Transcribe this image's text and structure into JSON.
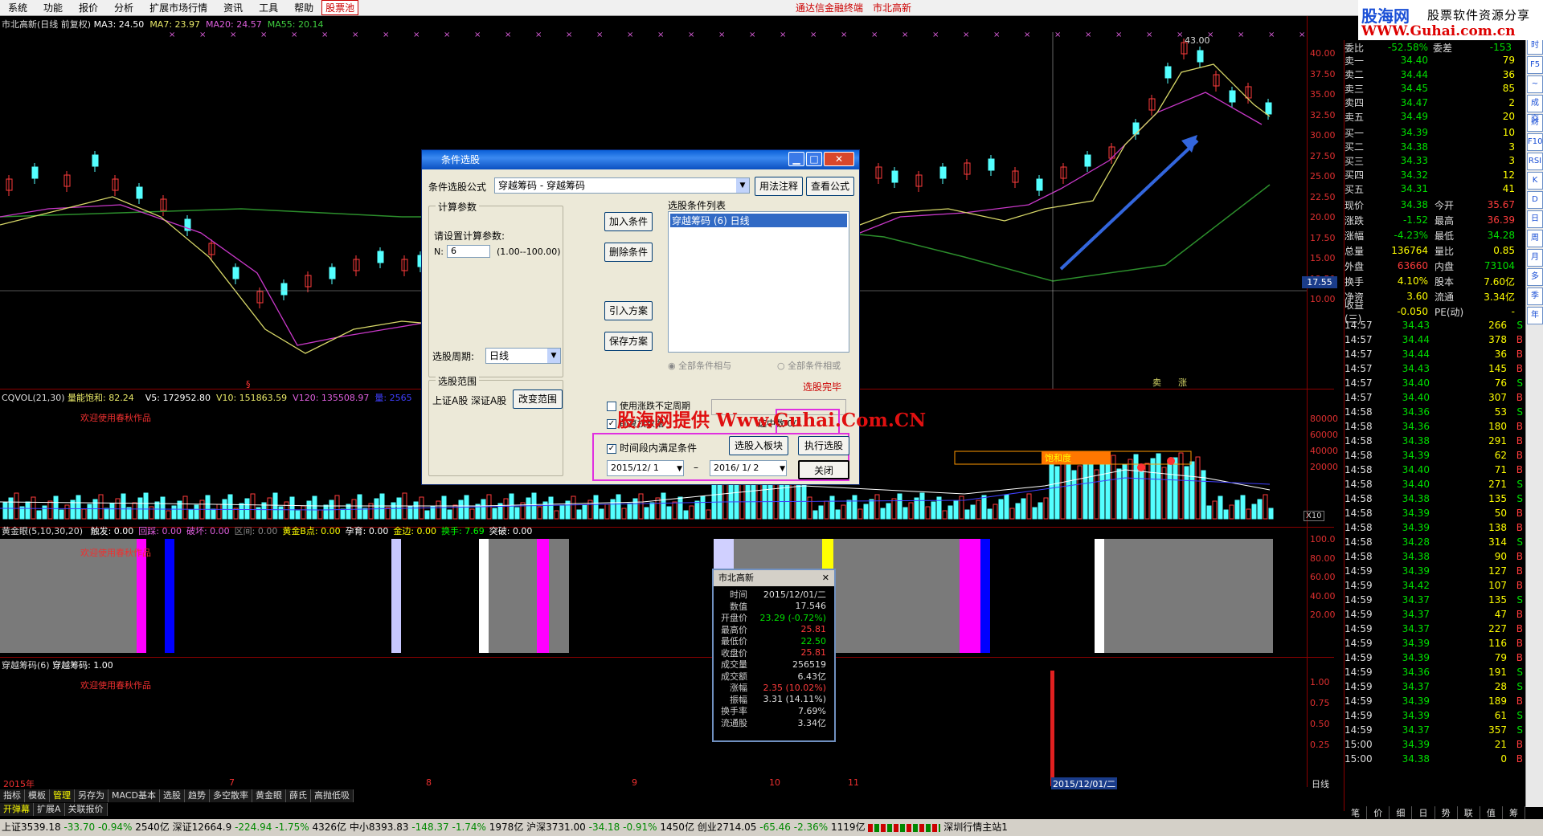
{
  "menu": {
    "items": [
      "系统",
      "功能",
      "报价",
      "分析",
      "扩展市场行情",
      "资讯",
      "工具",
      "帮助"
    ],
    "hot": "股票池",
    "center1": "通达信金融终端",
    "center2": "市北高新"
  },
  "logo": {
    "site": "股海网",
    "slogan": "股票软件资源分享",
    "url": "WWW.Guhai.com.cn"
  },
  "kline": {
    "header": "市北高新(日线 前复权)",
    "ma3": "MA3: 24.50",
    "ma7": "MA7: 23.97",
    "ma20": "MA20: 24.57",
    "ma55": "MA55: 20.14",
    "peak": "43.00",
    "cross_price": "17.55",
    "yaxis": [
      "40.00",
      "37.50",
      "35.00",
      "32.50",
      "30.00",
      "27.50",
      "25.00",
      "22.50",
      "20.00",
      "17.50",
      "15.00",
      "12.50",
      "10.00"
    ],
    "marks": [
      "卖",
      "涨"
    ]
  },
  "vol": {
    "header": "CQVOL(21,30)",
    "sat": "量能饱和: 82.24",
    "v5": "V5: 172952.80",
    "v10": "V10: 151863.59",
    "v120": "V120: 135508.97",
    "vol": "量: 2565",
    "welcome": "欢迎使用春秋作品",
    "yaxis": [
      "80000",
      "60000",
      "40000",
      "20000"
    ],
    "scale": "X10",
    "band": "饱和度"
  },
  "gold": {
    "header": "黄金眼(5,10,30,20)",
    "items": [
      {
        "k": "触发",
        "v": "0.00"
      },
      {
        "k": "回踩",
        "v": "0.00"
      },
      {
        "k": "破坏",
        "v": "0.00"
      },
      {
        "k": "区间",
        "v": "0.00"
      },
      {
        "k": "黄金B点",
        "v": "0.00"
      },
      {
        "k": "孕育",
        "v": "0.00"
      },
      {
        "k": "金边",
        "v": "0.00"
      },
      {
        "k": "换手",
        "v": "7.69"
      },
      {
        "k": "突破",
        "v": "0.00"
      }
    ],
    "welcome": "欢迎使用春秋作品",
    "yaxis": [
      "100.0",
      "80.00",
      "60.00",
      "40.00",
      "20.00"
    ]
  },
  "chip": {
    "header": "穿越筹码(6)",
    "value": "穿越筹码: 1.00",
    "welcome": "欢迎使用春秋作品",
    "yaxis": [
      "1.00",
      "0.75",
      "0.50",
      "0.25"
    ]
  },
  "xaxis": {
    "labels": [
      "2015年",
      "7",
      "8",
      "9",
      "10",
      "11"
    ],
    "cursor": "2015/12/01/二",
    "period": "日线"
  },
  "quote": {
    "header": {
      "k1": "委比",
      "v1": "-52.58%",
      "k2": "委差",
      "v2": "-153"
    },
    "asks": [
      {
        "k": "卖五",
        "p": "34.49",
        "v": "20"
      },
      {
        "k": "卖四",
        "p": "34.47",
        "v": "2"
      },
      {
        "k": "卖三",
        "p": "34.45",
        "v": "85"
      },
      {
        "k": "卖二",
        "p": "34.44",
        "v": "36"
      },
      {
        "k": "卖一",
        "p": "34.40",
        "v": "79"
      }
    ],
    "bids": [
      {
        "k": "买一",
        "p": "34.39",
        "v": "10"
      },
      {
        "k": "买二",
        "p": "34.38",
        "v": "3"
      },
      {
        "k": "买三",
        "p": "34.33",
        "v": "3"
      },
      {
        "k": "买四",
        "p": "34.32",
        "v": "12"
      },
      {
        "k": "买五",
        "p": "34.31",
        "v": "41"
      }
    ],
    "stats": [
      {
        "k1": "现价",
        "v1": "34.38",
        "k2": "今开",
        "v2": "35.67"
      },
      {
        "k1": "涨跌",
        "v1": "-1.52",
        "k2": "最高",
        "v2": "36.39"
      },
      {
        "k1": "涨幅",
        "v1": "-4.23%",
        "k2": "最低",
        "v2": "34.28"
      },
      {
        "k1": "总量",
        "v1": "136764",
        "k2": "量比",
        "v2": "0.85"
      },
      {
        "k1": "外盘",
        "v1": "63660",
        "k2": "内盘",
        "v2": "73104"
      },
      {
        "k1": "换手",
        "v1": "4.10%",
        "k2": "股本",
        "v2": "7.60亿"
      },
      {
        "k1": "净资",
        "v1": "3.60",
        "k2": "流通",
        "v2": "3.34亿"
      },
      {
        "k1": "收益(三)",
        "v1": "-0.050",
        "k2": "PE(动)",
        "v2": "-"
      }
    ],
    "ticks": [
      [
        "14:57",
        "34.43",
        "266",
        "S"
      ],
      [
        "14:57",
        "34.44",
        "378",
        "B"
      ],
      [
        "14:57",
        "34.44",
        "36",
        "B"
      ],
      [
        "14:57",
        "34.43",
        "145",
        "B"
      ],
      [
        "14:57",
        "34.40",
        "76",
        "S"
      ],
      [
        "14:57",
        "34.40",
        "307",
        "B"
      ],
      [
        "14:58",
        "34.36",
        "53",
        "S"
      ],
      [
        "14:58",
        "34.36",
        "180",
        "B"
      ],
      [
        "14:58",
        "34.38",
        "291",
        "B"
      ],
      [
        "14:58",
        "34.39",
        "62",
        "B"
      ],
      [
        "14:58",
        "34.40",
        "71",
        "B"
      ],
      [
        "14:58",
        "34.40",
        "271",
        "S"
      ],
      [
        "14:58",
        "34.38",
        "135",
        "S"
      ],
      [
        "14:58",
        "34.39",
        "50",
        "B"
      ],
      [
        "14:58",
        "34.39",
        "138",
        "B"
      ],
      [
        "14:58",
        "34.28",
        "314",
        "S"
      ],
      [
        "14:58",
        "34.38",
        "90",
        "B"
      ],
      [
        "14:59",
        "34.39",
        "127",
        "B"
      ],
      [
        "14:59",
        "34.42",
        "107",
        "B"
      ],
      [
        "14:59",
        "34.37",
        "135",
        "S"
      ],
      [
        "14:59",
        "34.37",
        "47",
        "B"
      ],
      [
        "14:59",
        "34.37",
        "227",
        "B"
      ],
      [
        "14:59",
        "34.39",
        "116",
        "B"
      ],
      [
        "14:59",
        "34.39",
        "79",
        "B"
      ],
      [
        "14:59",
        "34.36",
        "191",
        "S"
      ],
      [
        "14:59",
        "34.37",
        "28",
        "S"
      ],
      [
        "14:59",
        "34.39",
        "189",
        "B"
      ],
      [
        "14:59",
        "34.39",
        "61",
        "S"
      ],
      [
        "14:59",
        "34.37",
        "357",
        "S"
      ],
      [
        "15:00",
        "34.39",
        "21",
        "B"
      ],
      [
        "15:00",
        "34.38",
        "0",
        "B"
      ]
    ],
    "tabs": [
      "笔",
      "价",
      "细",
      "日",
      "势",
      "联",
      "值",
      "筹"
    ]
  },
  "side": [
    "分",
    "时",
    "F5",
    "~",
    "成交",
    "财",
    "F10",
    "RSI",
    "K",
    "D",
    "日",
    "周",
    "月",
    "多",
    "季",
    "年"
  ],
  "dialog": {
    "title": "条件选股",
    "formula_label": "条件选股公式",
    "formula_value": "穿越筹码     - 穿越筹码",
    "usage": "用法注释",
    "view": "查看公式",
    "calc_group": "计算参数",
    "calc_hint": "请设置计算参数:",
    "n_label": "N:",
    "n_value": "6",
    "n_range": "(1.00--100.00)",
    "add": "加入条件",
    "del": "删除条件",
    "import": "引入方案",
    "save": "保存方案",
    "list_label": "选股条件列表",
    "list_item": "穿越筹码 (6) 日线",
    "period_label": "选股周期:",
    "period_value": "日线",
    "and": "全部条件相与",
    "or": "全部条件相或",
    "range_group": "选股范围",
    "range_value": "上证A股 深证A股",
    "change_range": "改变范围",
    "done": "选股完毕",
    "uncertain": "使用涨跌不定周期",
    "prev_ex": "前复权数据",
    "count": "0/3",
    "count2": "选中数",
    "timecond": "时间段内满足条件",
    "to_block": "选股入板块",
    "execute": "执行选股",
    "date_from": "2015/12/ 1",
    "date_to": "2016/ 1/ 2",
    "close": "关闭"
  },
  "watermark": "股海网提供 Www.Guhai.Com.CN",
  "popup": {
    "title": "市北高新",
    "rows": [
      {
        "k": "时间",
        "v": "2015/12/01/二"
      },
      {
        "k": "数值",
        "v": "17.546"
      },
      {
        "k": "开盘价",
        "v": "23.29 (-0.72%)"
      },
      {
        "k": "最高价",
        "v": "25.81"
      },
      {
        "k": "最低价",
        "v": "22.50"
      },
      {
        "k": "收盘价",
        "v": "25.81"
      },
      {
        "k": "成交量",
        "v": "256519"
      },
      {
        "k": "成交额",
        "v": "6.43亿"
      },
      {
        "k": "涨幅",
        "v": "2.35 (10.02%)"
      },
      {
        "k": "振幅",
        "v": "3.31 (14.11%)"
      },
      {
        "k": "换手率",
        "v": "7.69%"
      },
      {
        "k": "流通股",
        "v": "3.34亿"
      }
    ]
  },
  "tabs": [
    "指标",
    "模板",
    "管理",
    "另存为",
    "MACD基本",
    "选股",
    "趋势",
    "多空散率",
    "黄金眼",
    "薛氏",
    "高抛低吸"
  ],
  "tabs2": [
    "开弹幕",
    "扩展A",
    "关联报价"
  ],
  "status": {
    "sh": "上证3539.18",
    "sh_ch": "-33.70",
    "sh_pct": "-0.94%",
    "sh_amt": "2540亿",
    "sz": "深证12664.9",
    "sz_ch": "-224.94",
    "sz_pct": "-1.75%",
    "sz_amt": "4326亿",
    "zx": "中小8393.83",
    "zx_ch": "-148.37",
    "zx_pct": "-1.74%",
    "zx_amt": "1978亿",
    "hs": "沪深3731.00",
    "hs_ch": "-34.18",
    "hs_pct": "-0.91%",
    "hs_amt": "1450亿",
    "cy": "创业2714.05",
    "cy_ch": "-65.46",
    "cy_pct": "-2.36%",
    "cy_amt": "1119亿",
    "station": "深圳行情主站1"
  }
}
